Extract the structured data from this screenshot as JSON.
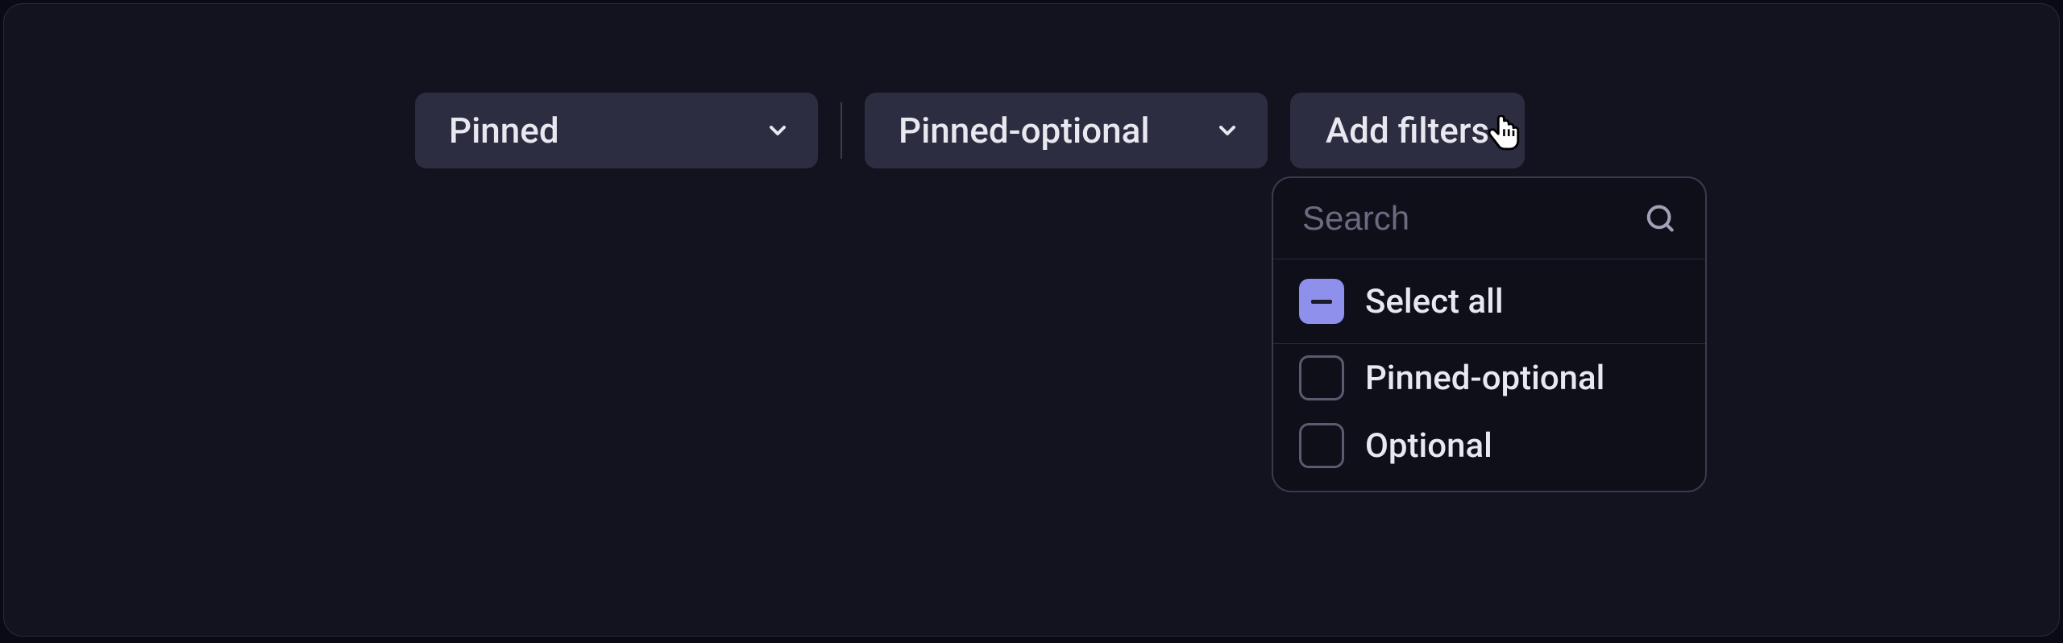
{
  "toolbar": {
    "pinned_label": "Pinned",
    "pinned_optional_label": "Pinned-optional",
    "add_filters_label": "Add filters"
  },
  "popover": {
    "search_placeholder": "Search",
    "select_all_label": "Select all",
    "options": [
      {
        "label": "Pinned-optional"
      },
      {
        "label": "Optional"
      }
    ]
  }
}
